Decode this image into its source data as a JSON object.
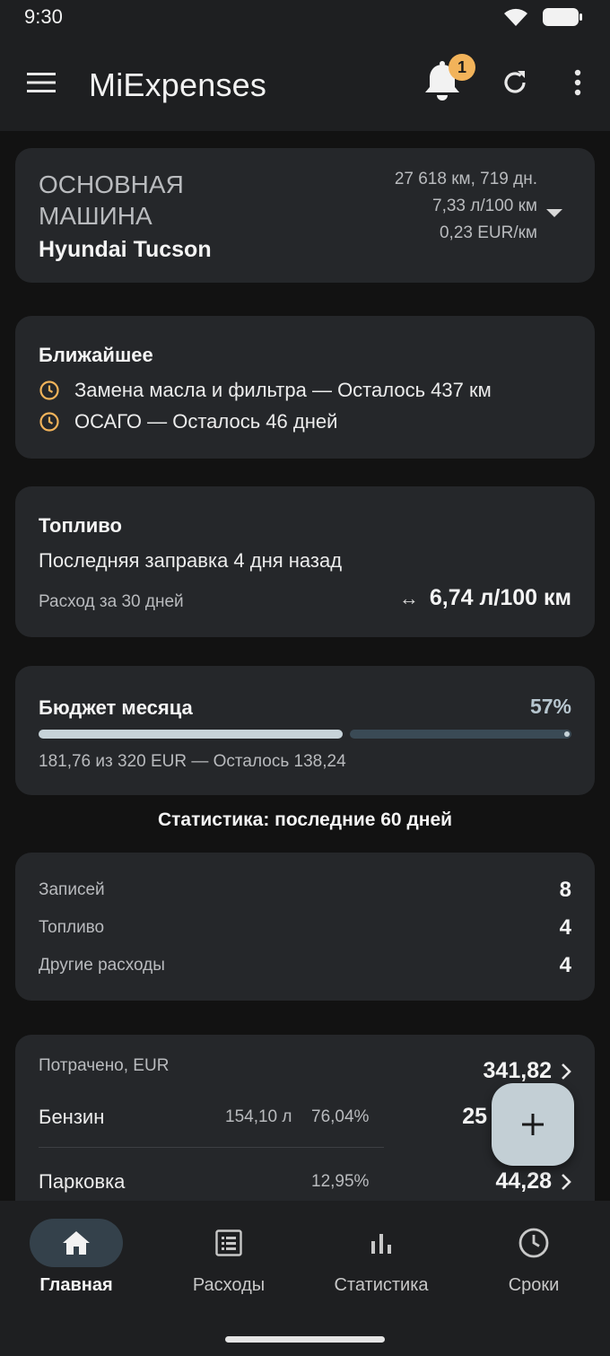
{
  "status_bar": {
    "time": "9:30"
  },
  "app_bar": {
    "title": "MiExpenses",
    "notification_count": "1"
  },
  "vehicle": {
    "label": "ОСНОВНАЯ МАШИНА",
    "name": "Hyundai Tucson",
    "stats": [
      "27 618 км, 719 дн.",
      "7,33 л/100 км",
      "0,23 EUR/км"
    ]
  },
  "upcoming": {
    "title": "Ближайшее",
    "items": [
      "Замена масла и фильтра — Осталось 437 км",
      "ОСАГО — Осталось 46 дней"
    ]
  },
  "fuel": {
    "title": "Топливо",
    "last_refuel": "Последняя заправка 4 дня назад",
    "consumption_label": "Расход за 30 дней",
    "consumption_value": "6,74 л/100 км"
  },
  "budget": {
    "title": "Бюджет месяца",
    "percent": "57%",
    "progress_fraction": 0.57,
    "summary": "181,76 из 320 EUR — Осталось 138,24"
  },
  "stats_title": "Статистика: последние 60 дней",
  "counts": [
    {
      "label": "Записей",
      "value": "8"
    },
    {
      "label": "Топливо",
      "value": "4"
    },
    {
      "label": "Другие расходы",
      "value": "4"
    }
  ],
  "spent": {
    "label": "Потрачено, EUR",
    "total": "341,82",
    "rows": [
      {
        "name": "Бензин",
        "qty": "154,10 л",
        "pct": "76,04%",
        "amount": "25"
      },
      {
        "name": "Парковка",
        "qty": "",
        "pct": "12,95%",
        "amount": "44,28"
      }
    ]
  },
  "bottom_nav": {
    "items": [
      {
        "label": "Главная",
        "icon": "home-icon",
        "active": true
      },
      {
        "label": "Расходы",
        "icon": "list-icon",
        "active": false
      },
      {
        "label": "Статистика",
        "icon": "bar-chart-icon",
        "active": false
      },
      {
        "label": "Сроки",
        "icon": "clock-icon",
        "active": false
      }
    ]
  },
  "colors": {
    "background": "#121212",
    "surface": "#25272a",
    "accent": "#c3cfd5",
    "badge": "#f2b35a",
    "reminder_icon": "#f2b35a"
  }
}
